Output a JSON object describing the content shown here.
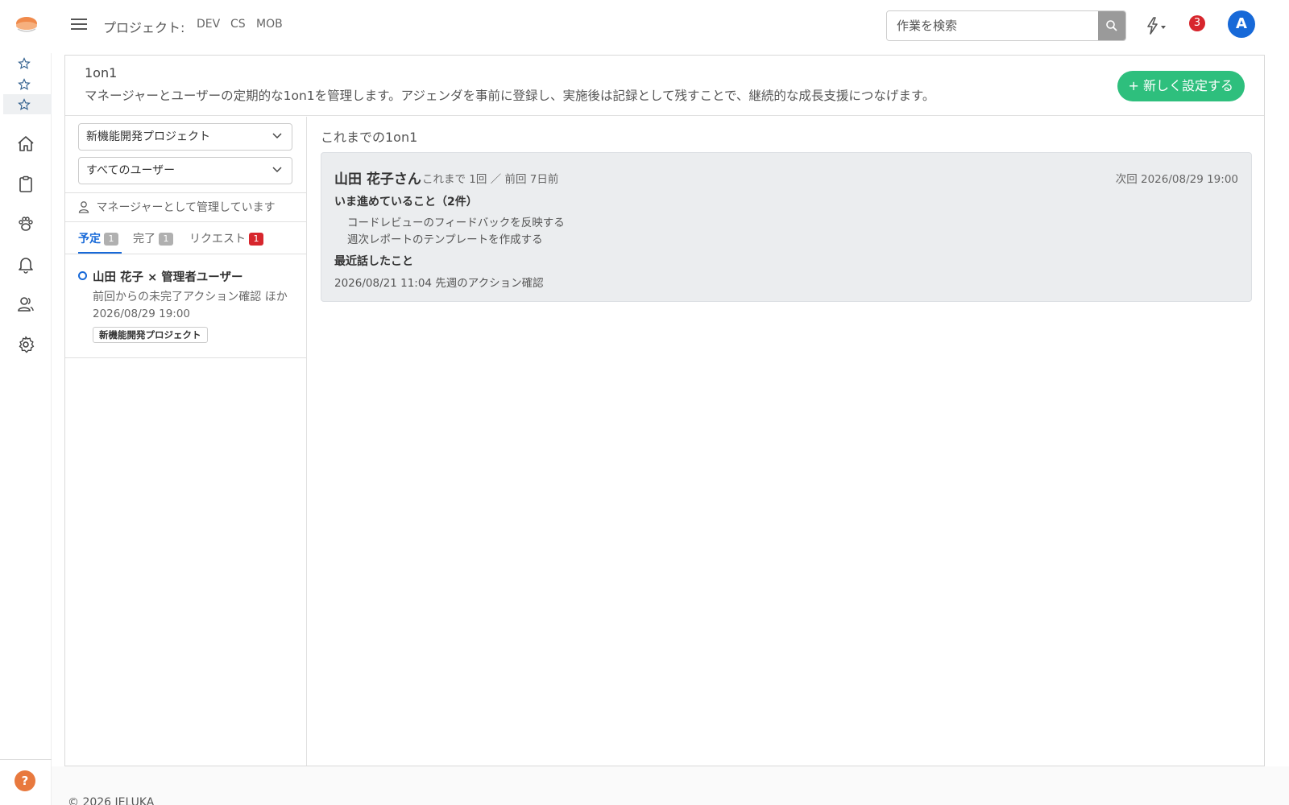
{
  "header": {
    "project_label": "プロジェクト:",
    "projects": [
      "DEV",
      "CS",
      "MOB"
    ],
    "search_placeholder": "作業を検索",
    "notification_count": "3",
    "avatar_initial": "A"
  },
  "page": {
    "title": "1on1",
    "description": "マネージャーとユーザーの定期的な1on1を管理します。アジェンダを事前に登録し、実施後は記録として残すことで、継続的な成長支援につなげます。",
    "new_button": "+ 新しく設定する"
  },
  "filters": {
    "project_select": "新機能開発プロジェクト",
    "user_select": "すべてのユーザー",
    "manager_note": "マネージャーとして管理しています"
  },
  "tabs": [
    {
      "label": "予定",
      "count": "1"
    },
    {
      "label": "完了",
      "count": "1"
    },
    {
      "label": "リクエスト",
      "count": "1"
    }
  ],
  "list_item": {
    "title": "山田 花子 × 管理者ユーザー",
    "subtitle": "前回からの未完了アクション確認 ほか",
    "date": "2026/08/29 19:00",
    "tag": "新機能開発プロジェクト"
  },
  "history": {
    "title": "これまでの1on1",
    "name": "山田 花子さん",
    "meta": "これまで 1回 ／ 前回 7日前",
    "next": "次回 2026/08/29 19:00",
    "in_progress_heading": "いま進めていること（2件）",
    "in_progress_items": [
      "コードレビューのフィードバックを反映する",
      "週次レポートのテンプレートを作成する"
    ],
    "recent_heading": "最近話したこと",
    "recent": "2026/08/21 11:04  先週のアクション確認"
  },
  "footer": {
    "copyright": "© 2026 IELUKA"
  },
  "colors": {
    "accent_blue": "#1769d8",
    "primary_green": "#2ebf7d",
    "badge_red": "#d7262d",
    "logo_orange": "#f08a4b"
  }
}
